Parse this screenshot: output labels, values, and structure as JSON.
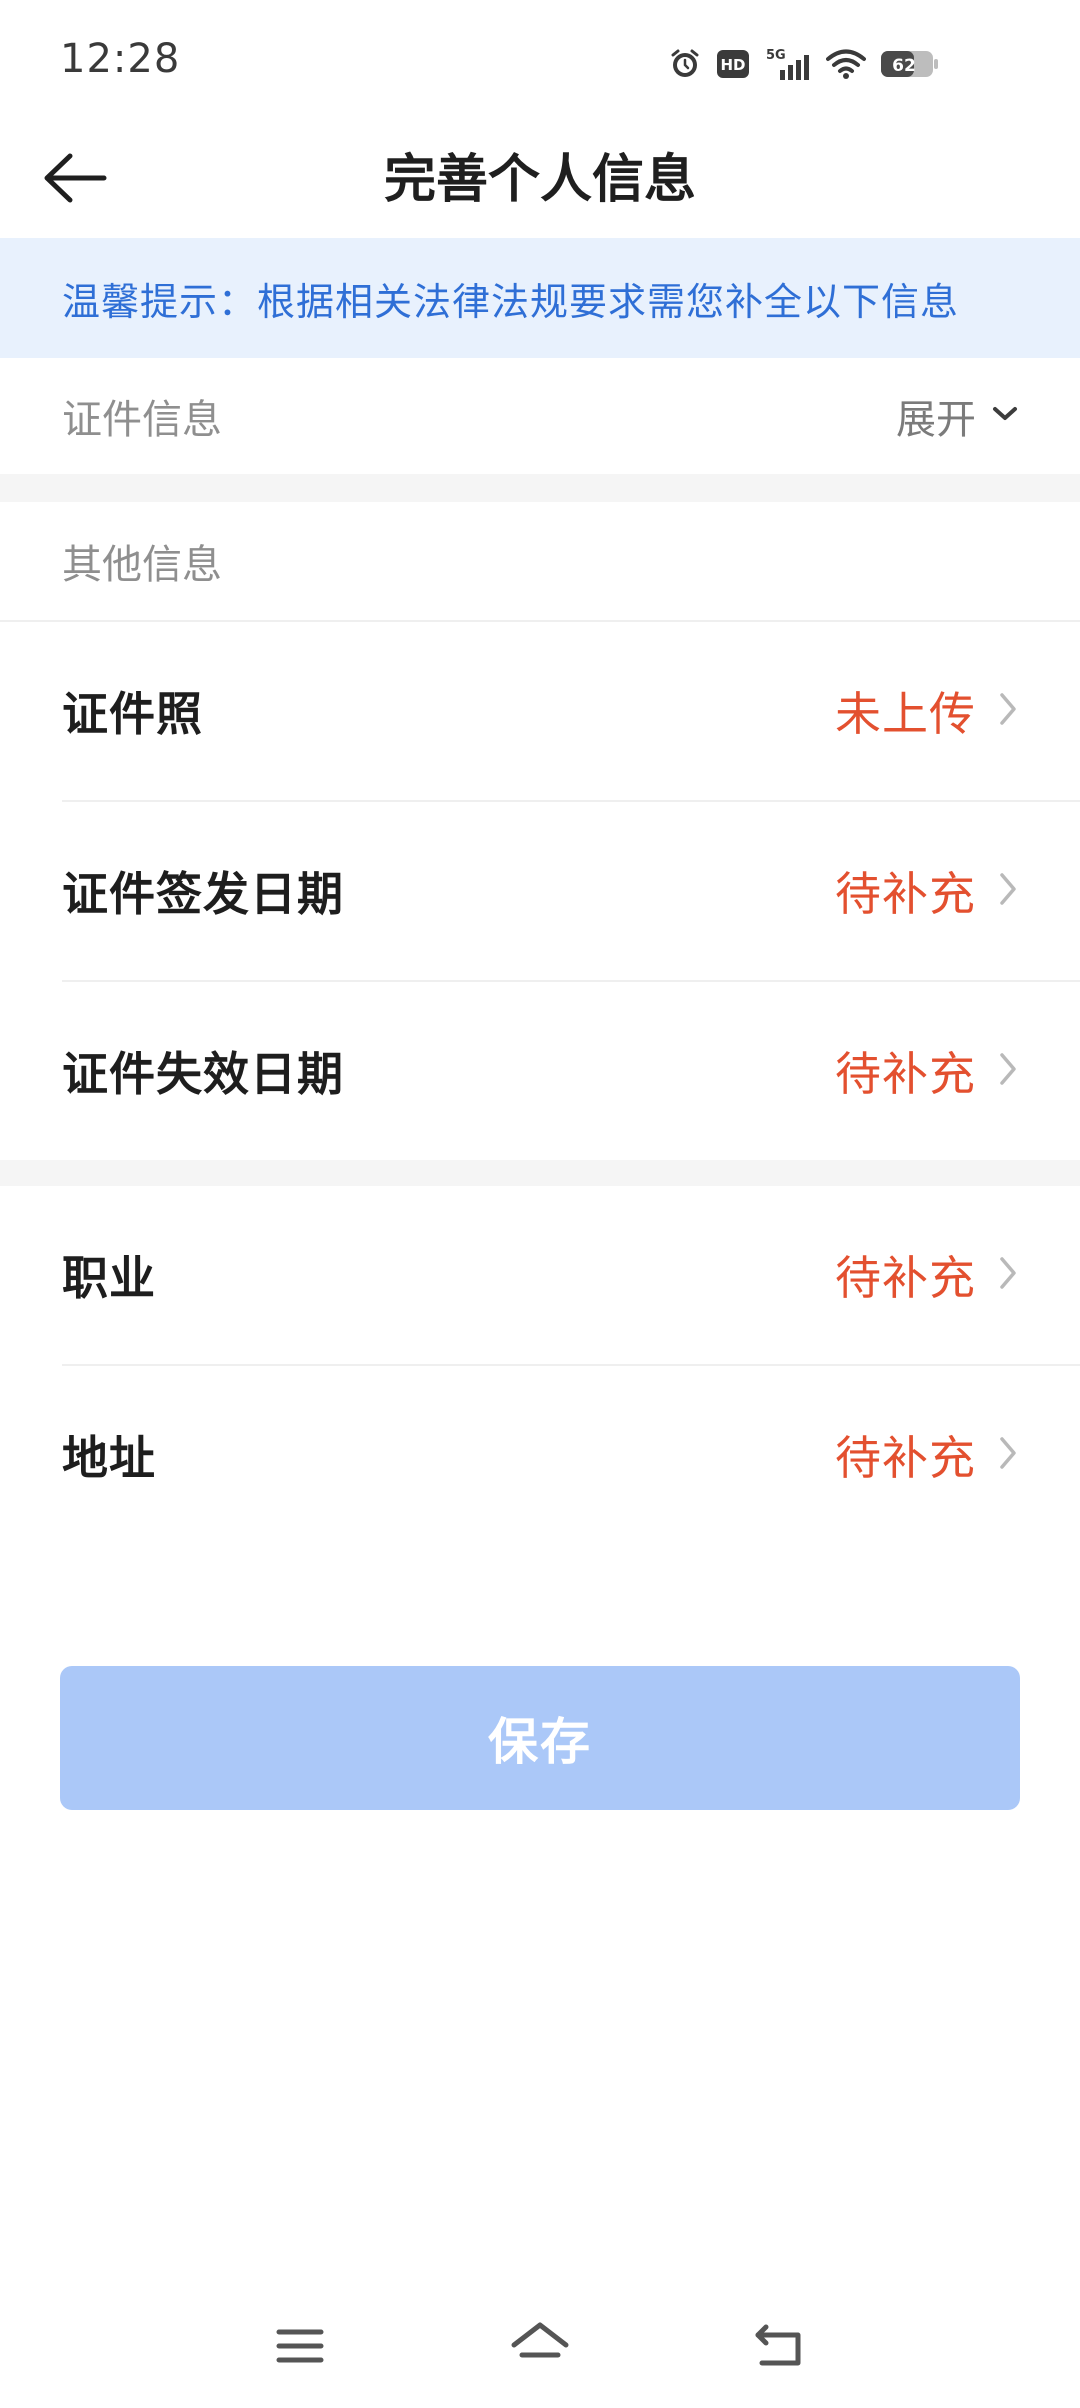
{
  "status_bar": {
    "time": "12:28",
    "battery_level": "62",
    "network": "5G",
    "hd_badge": "HD",
    "icons": [
      "alarm-icon",
      "hd-icon",
      "signal-5g-icon",
      "wifi-icon",
      "battery-icon"
    ]
  },
  "header": {
    "title": "完善个人信息",
    "back_icon": "arrow-left-icon"
  },
  "tip": {
    "text": "温馨提示：根据相关法律法规要求需您补全以下信息"
  },
  "sections": {
    "id_info": {
      "label": "证件信息",
      "toggle_label": "展开",
      "toggle_icon": "chevron-down-icon"
    },
    "other_info": {
      "label": "其他信息"
    }
  },
  "rows": [
    {
      "label": "证件照",
      "status": "未上传"
    },
    {
      "label": "证件签发日期",
      "status": "待补充"
    },
    {
      "label": "证件失效日期",
      "status": "待补充"
    },
    {
      "label": "职业",
      "status": "待补充"
    },
    {
      "label": "地址",
      "status": "待补充"
    }
  ],
  "save_button": {
    "label": "保存"
  },
  "nav_bar": {
    "icons": [
      "menu-icon",
      "home-icon",
      "back-nav-icon"
    ]
  },
  "colors": {
    "accent": "#2f6fd6",
    "tip_background": "#e8f1fd",
    "status_red": "#e3502f",
    "button_disabled": "#abc8f8"
  }
}
